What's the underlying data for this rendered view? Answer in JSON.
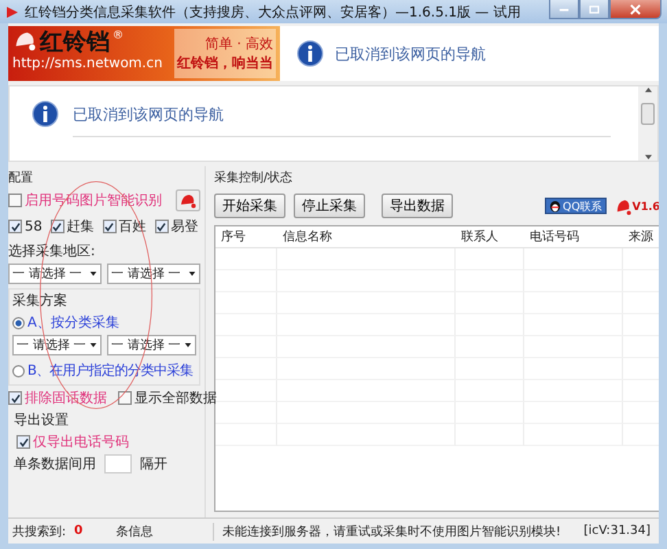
{
  "window": {
    "title": "红铃铛分类信息采集软件（支持搜房、大众点评网、安居客）—1.6.5.1版 — 试用"
  },
  "banner": {
    "logo_name": "红铃铛",
    "logo_mark": "®",
    "logo_url": "http://sms.netwom.cn",
    "slogan_1": "简单 · 高效",
    "slogan_2": "红铃铛，响当当",
    "message": "已取消到该网页的导航"
  },
  "browser": {
    "message": "已取消到该网页的导航"
  },
  "config": {
    "title": "配置",
    "ocr": {
      "label": "启用号码图片智能识别",
      "checked": false
    },
    "sources": [
      {
        "label": "58",
        "checked": true
      },
      {
        "label": "赶集",
        "checked": true
      },
      {
        "label": "百姓",
        "checked": true
      },
      {
        "label": "易登",
        "checked": true
      }
    ],
    "region_label": "选择采集地区:",
    "region_selects": [
      "一 请选择 一",
      "一 请选择 一"
    ],
    "scheme": {
      "title": "采集方案",
      "options": [
        {
          "label": "A、按分类采集",
          "selected": true
        },
        {
          "label": "B、在用户指定的分类中采集",
          "selected": false
        }
      ],
      "selects": [
        "一 请选择 一",
        "一 请选择 一"
      ]
    },
    "exclude_landline": {
      "label": "排除固话数据",
      "checked": true
    },
    "show_all": {
      "label": "显示全部数据",
      "checked": false
    },
    "export": {
      "title": "导出设置",
      "phone_only": {
        "label": "仅导出电话号码",
        "checked": true
      },
      "separator_label": "单条数据间用",
      "separator_suffix": "隔开"
    }
  },
  "control": {
    "title": "采集控制/状态",
    "buttons": [
      "开始采集",
      "停止采集",
      "导出数据"
    ],
    "qq_button": "QQ联系",
    "version": "V1.6"
  },
  "table": {
    "columns": [
      "序号",
      "信息名称",
      "联系人",
      "电话号码",
      "来源"
    ]
  },
  "status_bar": {
    "count_label": "共搜索到:",
    "count": "0",
    "count_unit": "条信息",
    "message": "未能连接到服务器，请重试或采集时不使用图片智能识别模块!",
    "code": "[icV:31.34]"
  }
}
